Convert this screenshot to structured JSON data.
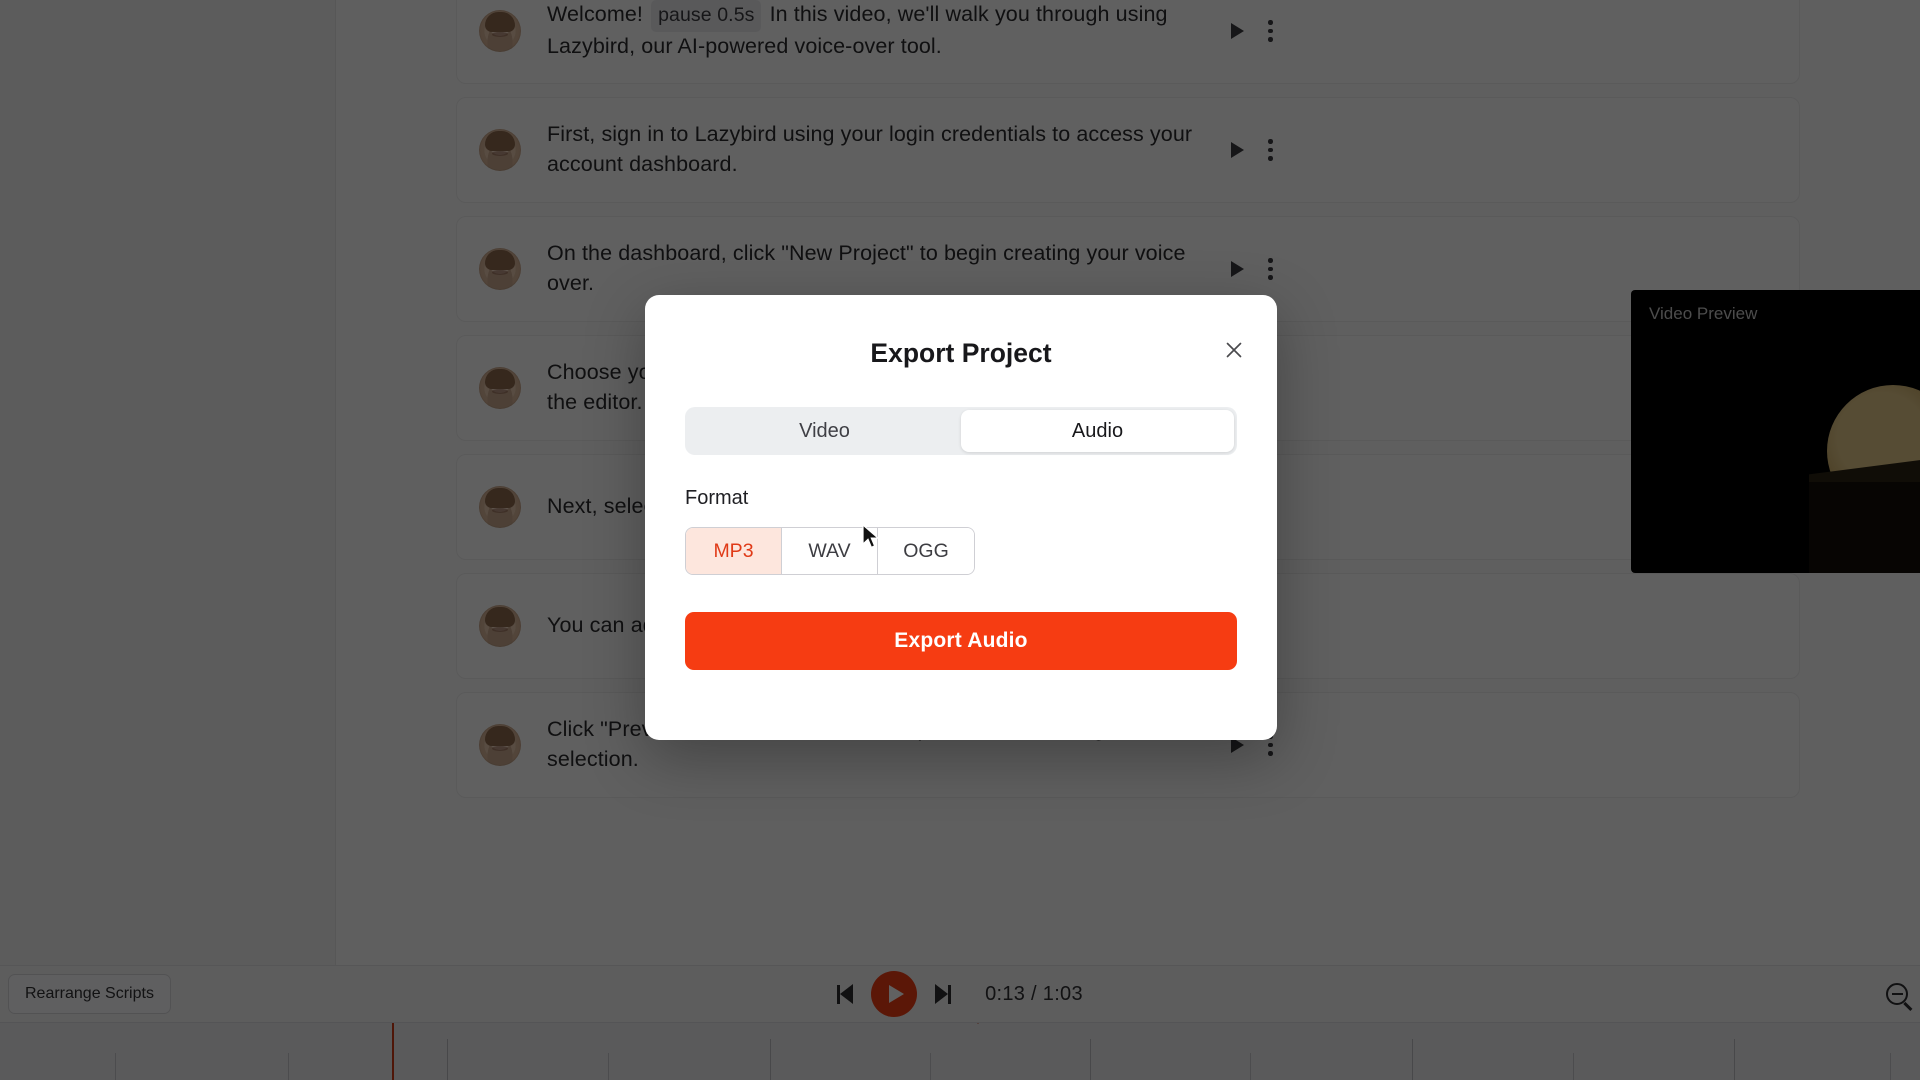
{
  "app": {
    "scripts": [
      {
        "pre": "Welcome!",
        "chip": "pause 0.5s",
        "post": "In this video, we'll walk you through using Lazybird, our AI-powered voice-over tool."
      },
      {
        "pre": "First, sign in to Lazybird using your login credentials to access your account dashboard.",
        "chip": "",
        "post": ""
      },
      {
        "pre": "On the dashboard, click \"New Project\" to begin creating your voice over.",
        "chip": "",
        "post": ""
      },
      {
        "pre": "Choose your script by uploading a document or typing it directly into the editor.",
        "chip": "",
        "post": ""
      },
      {
        "pre": "Next, select a voice from our library of different accents and styles.",
        "chip": "",
        "post": ""
      },
      {
        "pre": "You can adjust speed, pitch and tone to match your project's needs.",
        "chip": "",
        "post": ""
      },
      {
        "pre": "Click \"Preview\" to listen to a short sample before finalizing the voice selection.",
        "chip": "",
        "post": ""
      }
    ],
    "row_play_icon": "play-icon",
    "row_menu_icon": "kebab-menu-icon"
  },
  "preview": {
    "label": "Video Preview"
  },
  "bottom_bar": {
    "rearrange_label": "Rearrange Scripts",
    "prev_icon": "skip-previous-icon",
    "play_icon": "play-icon",
    "next_icon": "skip-next-icon",
    "time": "0:13 / 1:03",
    "zoom_out_icon": "zoom-out-icon"
  },
  "modal": {
    "title": "Export Project",
    "close_icon": "close-icon",
    "tabs": [
      {
        "label": "Video",
        "active": false
      },
      {
        "label": "Audio",
        "active": true
      }
    ],
    "format_label": "Format",
    "formats": [
      {
        "label": "MP3",
        "selected": true
      },
      {
        "label": "WAV",
        "selected": false
      },
      {
        "label": "OGG",
        "selected": false
      }
    ],
    "export_label": "Export Audio",
    "accent_color": "#f63c12",
    "selected_format_bg": "#fde6dd",
    "selected_format_fg": "#e03a17"
  }
}
